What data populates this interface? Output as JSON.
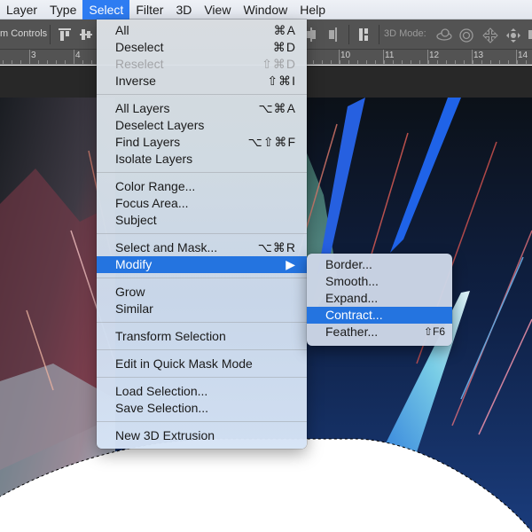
{
  "menubar": {
    "items": [
      {
        "label": "Layer",
        "active": false
      },
      {
        "label": "Type",
        "active": false
      },
      {
        "label": "Select",
        "active": true
      },
      {
        "label": "Filter",
        "active": false
      },
      {
        "label": "3D",
        "active": false
      },
      {
        "label": "View",
        "active": false
      },
      {
        "label": "Window",
        "active": false
      },
      {
        "label": "Help",
        "active": false
      }
    ]
  },
  "options_bar": {
    "transform_controls_label": "m Controls",
    "mode_3d_label": "3D Mode:",
    "icons": [
      "align-top-edges-icon",
      "align-vertical-centers-icon",
      "align-bottom-edges-icon",
      "align-left-edges-icon",
      "align-horizontal-centers-icon",
      "distribute-icon",
      "orbit-3d-icon",
      "roll-3d-icon",
      "pan-3d-icon",
      "slide-3d-icon",
      "scale-3d-icon"
    ]
  },
  "ruler": {
    "labels": [
      "3",
      "4",
      "10",
      "11",
      "12",
      "13",
      "14"
    ]
  },
  "select_menu": {
    "items": [
      {
        "label": "All",
        "shortcut": "⌘A"
      },
      {
        "label": "Deselect",
        "shortcut": "⌘D"
      },
      {
        "label": "Reselect",
        "shortcut": "⇧⌘D",
        "disabled": true
      },
      {
        "label": "Inverse",
        "shortcut": "⇧⌘I"
      },
      {
        "separator": true
      },
      {
        "label": "All Layers",
        "shortcut": "⌥⌘A"
      },
      {
        "label": "Deselect Layers",
        "shortcut": ""
      },
      {
        "label": "Find Layers",
        "shortcut": "⌥⇧⌘F"
      },
      {
        "label": "Isolate Layers",
        "shortcut": ""
      },
      {
        "separator": true
      },
      {
        "label": "Color Range...",
        "shortcut": ""
      },
      {
        "label": "Focus Area...",
        "shortcut": ""
      },
      {
        "label": "Subject",
        "shortcut": ""
      },
      {
        "separator": true
      },
      {
        "label": "Select and Mask...",
        "shortcut": "⌥⌘R"
      },
      {
        "label": "Modify",
        "shortcut": "▶",
        "highlighted": true,
        "submenu": true
      },
      {
        "separator": true
      },
      {
        "label": "Grow",
        "shortcut": ""
      },
      {
        "label": "Similar",
        "shortcut": ""
      },
      {
        "separator": true
      },
      {
        "label": "Transform Selection",
        "shortcut": ""
      },
      {
        "separator": true
      },
      {
        "label": "Edit in Quick Mask Mode",
        "shortcut": ""
      },
      {
        "separator": true
      },
      {
        "label": "Load Selection...",
        "shortcut": ""
      },
      {
        "label": "Save Selection...",
        "shortcut": ""
      },
      {
        "separator": true
      },
      {
        "label": "New 3D Extrusion",
        "shortcut": ""
      }
    ]
  },
  "modify_submenu": {
    "items": [
      {
        "label": "Border...",
        "shortcut": ""
      },
      {
        "label": "Smooth...",
        "shortcut": ""
      },
      {
        "label": "Expand...",
        "shortcut": ""
      },
      {
        "label": "Contract...",
        "shortcut": "",
        "highlighted": true
      },
      {
        "label": "Feather...",
        "shortcut": "⇧F6"
      }
    ]
  },
  "colors": {
    "menu_highlight": "#2474e0",
    "menubar_active": "#2e7cf2",
    "options_bar_bg": "#535353",
    "pasteboard_bg": "#282828"
  }
}
